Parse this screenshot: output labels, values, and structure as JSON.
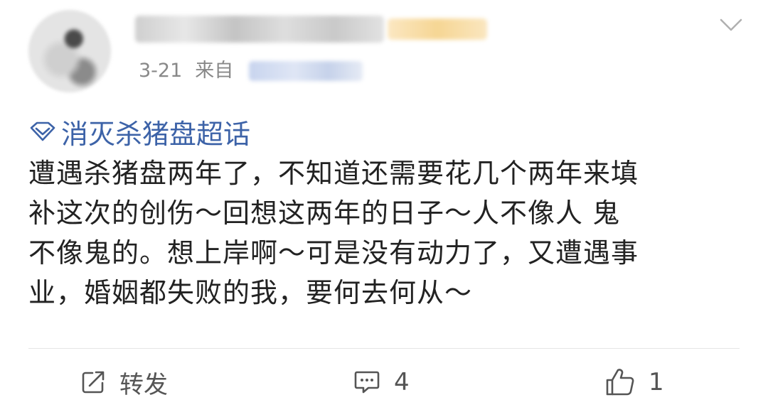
{
  "post": {
    "date": "3-21",
    "source_prefix": "来自",
    "topic": "消灭杀猪盘超话",
    "body": "遭遇杀猪盘两年了，不知道还需要花几个两年来填\n补这次的创伤～回想这两年的日子～人不像人 鬼\n不像鬼的。想上岸啊～可是没有动力了，又遭遇事\n业，婚姻都失败的我，要何去何从～"
  },
  "actions": {
    "repost_label": "转发",
    "comment_count": "4",
    "like_count": "1"
  },
  "colors": {
    "topic": "#3d63a8",
    "body_text": "#222222",
    "meta_text": "#888888",
    "action_text": "#555555"
  },
  "icons": {
    "chevron": "chevron-down-icon",
    "topic": "diamond-icon",
    "repost": "share-icon",
    "comment": "comment-icon",
    "like": "thumbs-up-icon"
  }
}
